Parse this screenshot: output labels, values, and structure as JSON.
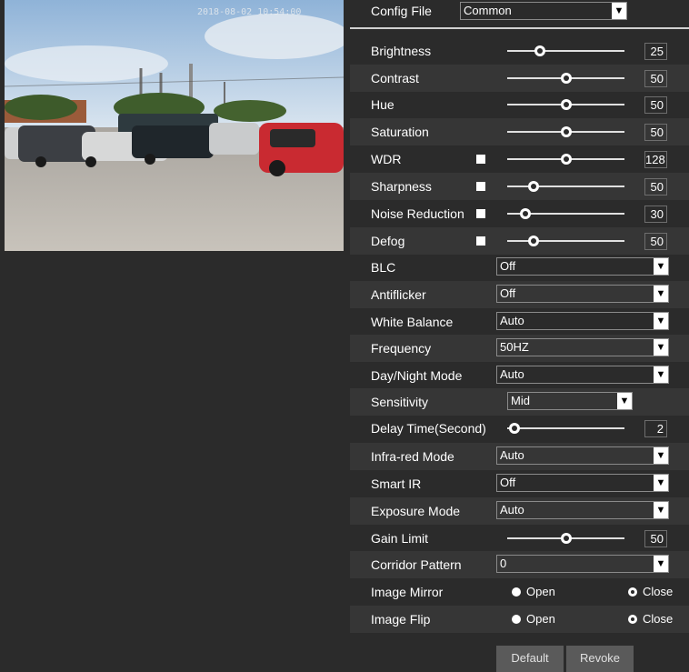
{
  "video": {
    "timestamp": "2018-08-02 10:54:00"
  },
  "config": {
    "label": "Config File",
    "value": "Common"
  },
  "sliders": [
    {
      "label": "Brightness",
      "value": "25",
      "level": 0.25
    },
    {
      "label": "Contrast",
      "value": "50",
      "level": 0.5
    },
    {
      "label": "Hue",
      "value": "50",
      "level": 0.5
    },
    {
      "label": "Saturation",
      "value": "50",
      "level": 0.5
    },
    {
      "label": "WDR",
      "value": "128",
      "level": 0.5,
      "checkbox": true
    },
    {
      "label": "Sharpness",
      "value": "50",
      "level": 0.2,
      "checkbox": true
    },
    {
      "label": "Noise Reduction",
      "value": "30",
      "level": 0.15,
      "checkbox": true
    },
    {
      "label": "Defog",
      "value": "50",
      "level": 0.2,
      "checkbox": true
    }
  ],
  "selects": {
    "blc": {
      "label": "BLC",
      "value": "Off"
    },
    "antiflicker": {
      "label": "Antiflicker",
      "value": "Off"
    },
    "white_balance": {
      "label": "White Balance",
      "value": "Auto"
    },
    "frequency": {
      "label": "Frequency",
      "value": "50HZ"
    },
    "day_night": {
      "label": "Day/Night Mode",
      "value": "Auto"
    },
    "sensitivity": {
      "label": "Sensitivity",
      "value": "Mid"
    },
    "infrared": {
      "label": "Infra-red Mode",
      "value": "Auto"
    },
    "smart_ir": {
      "label": "Smart IR",
      "value": "Off"
    },
    "exposure": {
      "label": "Exposure Mode",
      "value": "Auto"
    },
    "corridor": {
      "label": "Corridor Pattern",
      "value": "0"
    }
  },
  "delay": {
    "label": "Delay Time(Second)",
    "value": "2",
    "level": 0.05
  },
  "gain": {
    "label": "Gain Limit",
    "value": "50",
    "level": 0.5
  },
  "mirror": {
    "label": "Image Mirror",
    "open": "Open",
    "close": "Close"
  },
  "flip": {
    "label": "Image Flip",
    "open": "Open",
    "close": "Close"
  },
  "buttons": {
    "default": "Default",
    "revoke": "Revoke"
  }
}
